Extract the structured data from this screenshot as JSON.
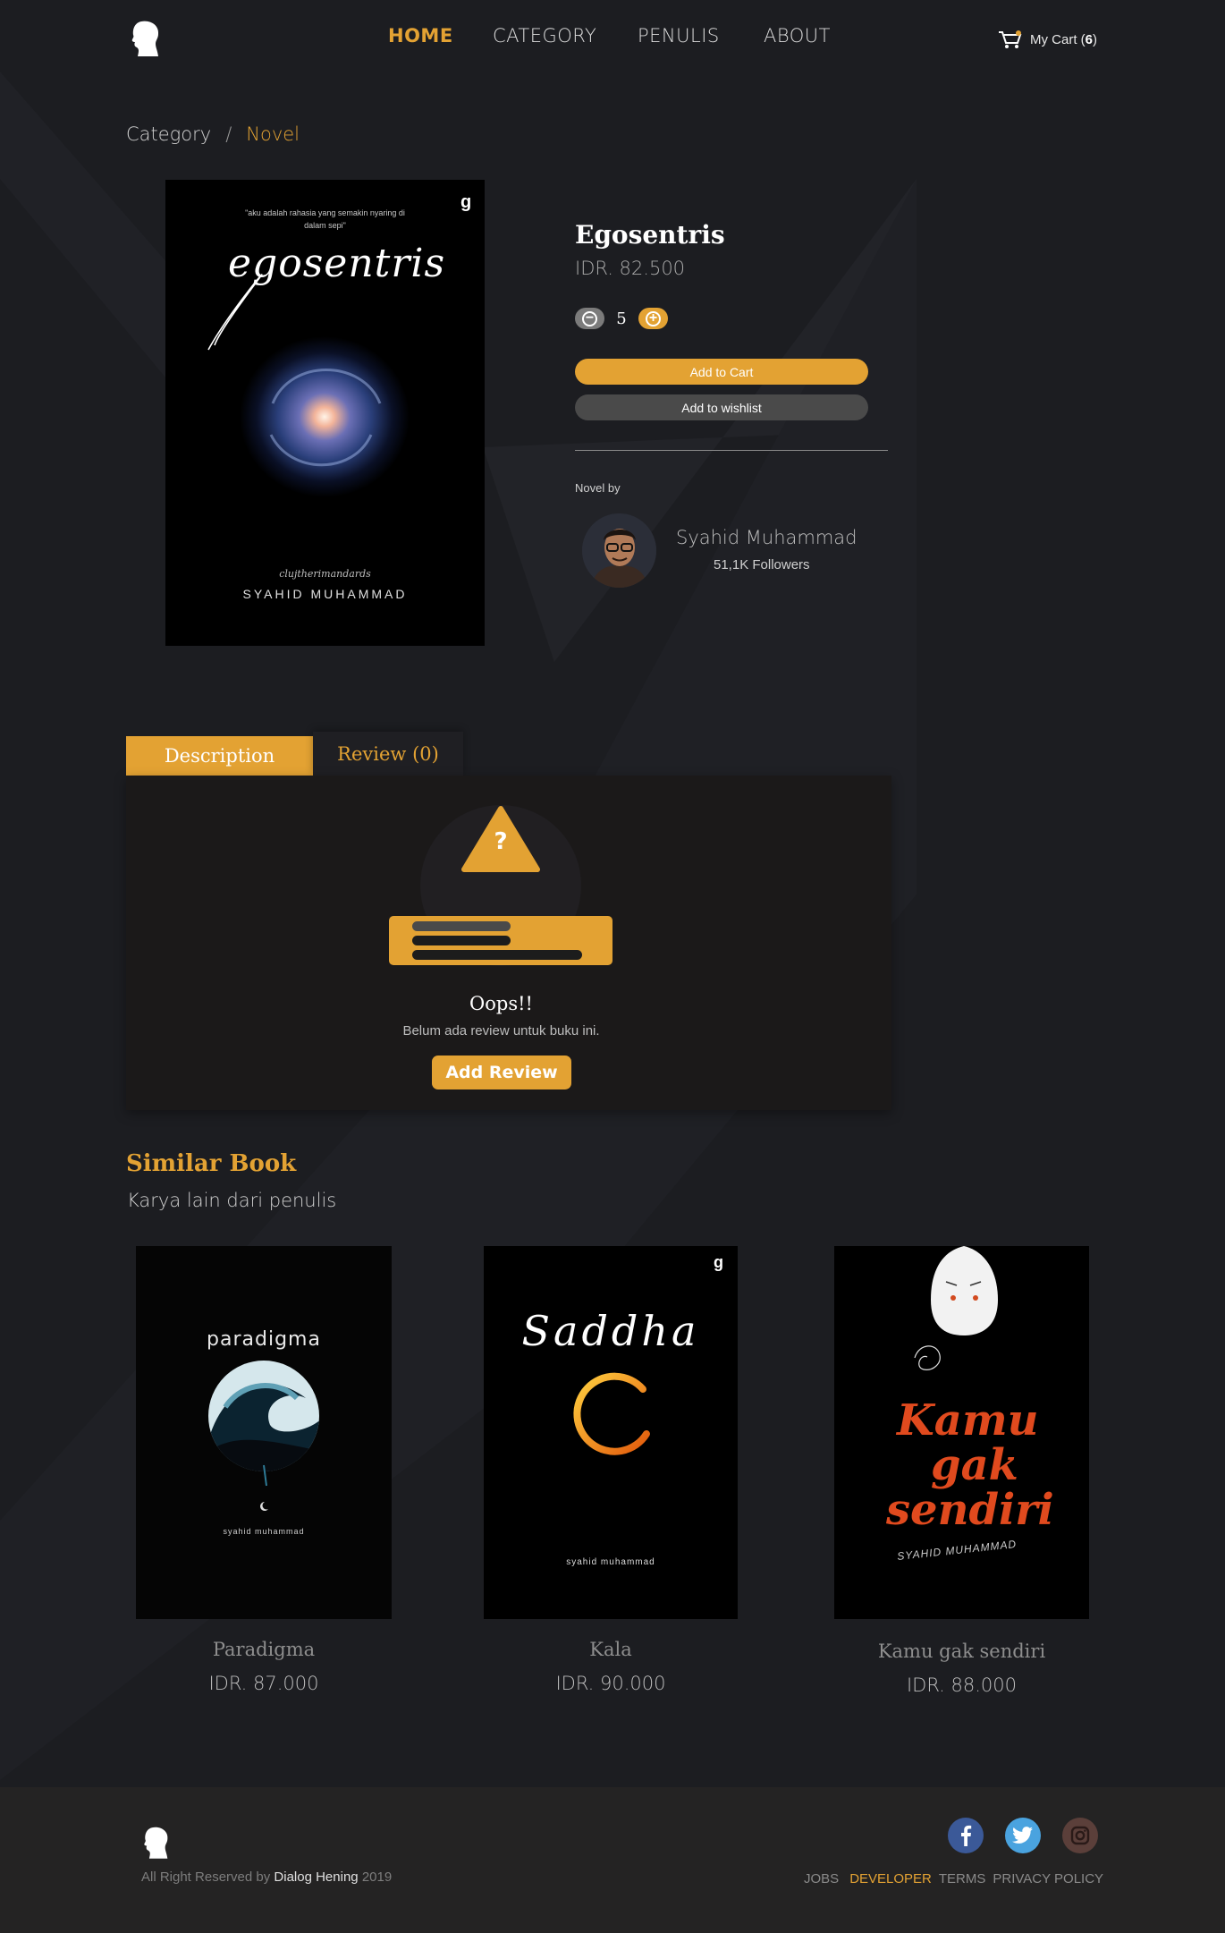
{
  "header": {
    "nav": [
      {
        "label": "HOME",
        "active": true
      },
      {
        "label": "CATEGORY",
        "active": false
      },
      {
        "label": "PENULIS",
        "active": false
      },
      {
        "label": "ABOUT",
        "active": false
      }
    ],
    "cart": {
      "label": "My Cart",
      "count": "6"
    },
    "logo_icon": "head-silhouette-icon"
  },
  "breadcrumb": {
    "items": [
      "Category",
      "Novel"
    ],
    "separator": "/"
  },
  "product": {
    "title": "Egosentris",
    "price": "IDR. 82.500",
    "quantity": "5",
    "add_to_cart_label": "Add to Cart",
    "add_to_wishlist_label": "Add to wishlist",
    "novel_by_label": "Novel by",
    "author": {
      "name": "Syahid Muhammad",
      "followers": "51,1K Followers"
    },
    "cover": {
      "quote": "\"aku adalah rahasia yang semakin nyaring di dalam sepi\"",
      "title": "egosentris",
      "signature": "clujtherimandards",
      "author": "SYAHID MUHAMMAD",
      "publisher_mark": "g"
    }
  },
  "tabs": [
    {
      "label": "Description",
      "active": true
    },
    {
      "label": "Review (0)",
      "active": false
    }
  ],
  "review_empty": {
    "title": "Oops!!",
    "message": "Belum ada review untuk buku ini.",
    "button": "Add Review",
    "warning_glyph": "?"
  },
  "similar": {
    "title": "Similar Book",
    "subtitle": "Karya lain dari penulis",
    "books": [
      {
        "title": "Paradigma",
        "price": "IDR. 87.000",
        "cover_title": "paradigma",
        "cover_author": "syahid muhammad"
      },
      {
        "title": "Kala",
        "price": "IDR. 90.000",
        "cover_title": "Saddha",
        "cover_author": "syahid muhammad"
      },
      {
        "title": "Kamu gak sendiri",
        "price": "IDR. 88.000",
        "cover_title_lines": [
          "Kamu",
          "gak",
          "sendiri"
        ],
        "cover_author": "SYAHID MUHAMMAD"
      }
    ]
  },
  "footer": {
    "copyright_prefix": "All Right Reserved by",
    "brand": "Dialog Hening",
    "year": "2019",
    "links": [
      "JOBS",
      "DEVELOPER",
      "TERMS",
      "PRIVACY POLICY"
    ],
    "social": [
      "facebook-icon",
      "twitter-icon",
      "instagram-icon"
    ]
  },
  "colors": {
    "accent": "#e3a233",
    "background": "#1c1d21",
    "footer": "#242323"
  }
}
